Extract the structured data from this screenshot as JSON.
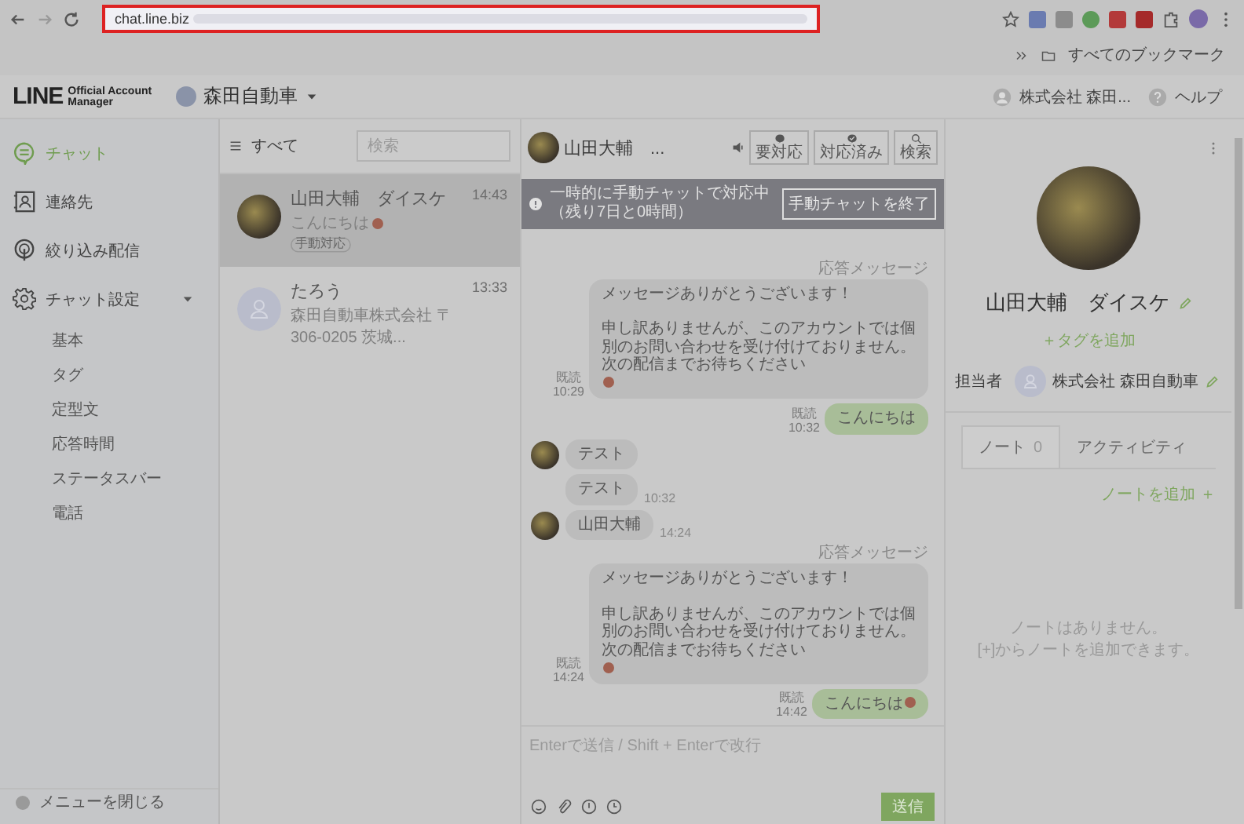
{
  "browser": {
    "url": "chat.line.biz",
    "bookmarks_label": "すべてのブックマーク"
  },
  "header": {
    "logo": "LINE",
    "logo_sub": [
      "Official Account",
      "Manager"
    ],
    "account": "森田自動車",
    "user": "株式会社 森田...",
    "help": "ヘルプ"
  },
  "sidebar": {
    "items": [
      {
        "kind": "chat",
        "label": "チャット",
        "selected": true
      },
      {
        "kind": "contacts",
        "label": "連絡先",
        "selected": false
      },
      {
        "kind": "broadcast",
        "label": "絞り込み配信",
        "selected": false
      },
      {
        "kind": "settings",
        "label": "チャット設定",
        "selected": false,
        "expanded": true,
        "children": [
          {
            "label": "基本",
            "selected": false
          },
          {
            "label": "タグ",
            "selected": false
          },
          {
            "label": "定型文",
            "selected": false
          },
          {
            "label": "応答時間",
            "selected": false
          },
          {
            "label": "ステータスバー",
            "selected": false
          },
          {
            "label": "電話",
            "selected": false
          }
        ]
      }
    ],
    "footer": "メニューを閉じる"
  },
  "chat_list": {
    "filter": "すべて",
    "search": {
      "placeholder": "検索"
    },
    "chats": [
      {
        "photo": true,
        "name": "山田大輔　ダイスケ",
        "preview": "こんにちは",
        "emoji": true,
        "tag": "手動対応",
        "time": "14:43",
        "selected": true
      },
      {
        "photo": false,
        "name": "たろう",
        "preview": "森田自動車株式会社 〒306-0205 茨城...",
        "emoji": false,
        "time": "13:33",
        "selected": false
      }
    ]
  },
  "chat": {
    "title": "山田大輔　...",
    "buttons": [
      {
        "kind": "pending",
        "label": "要対応"
      },
      {
        "kind": "done",
        "label": "対応済み"
      },
      {
        "kind": "search",
        "label": "検索"
      }
    ],
    "banner": {
      "text": "一時的に手動チャットで対応中",
      "remaining": "（残り7日と0時間）",
      "button": "手動チャットを終了"
    },
    "messages": [
      {
        "kind": "auto_reply",
        "label": "応答メッセージ",
        "paragraphs": [
          "メッセージありがとうございます！",
          "申し訳ありませんが、このアカウントでは個別のお問い合わせを受け付けておりません。次の配信までお待ちください"
        ],
        "emoji": true,
        "status": "既読",
        "time": "10:29"
      },
      {
        "kind": "outgoing",
        "text": "こんにちは",
        "emoji": false,
        "status": "既読",
        "time": "10:32"
      },
      {
        "kind": "incoming",
        "avatar": true,
        "text": "テスト"
      },
      {
        "kind": "incoming",
        "avatar": false,
        "text": "テスト",
        "time": "10:32"
      },
      {
        "kind": "incoming",
        "avatar": true,
        "text": "山田大輔",
        "time": "14:24"
      },
      {
        "kind": "auto_reply",
        "label": "応答メッセージ",
        "paragraphs": [
          "メッセージありがとうございます！",
          "申し訳ありませんが、このアカウントでは個別のお問い合わせを受け付けておりません。次の配信までお待ちください"
        ],
        "emoji": true,
        "status": "既読",
        "time": "14:24"
      },
      {
        "kind": "outgoing",
        "text": "こんにちは",
        "emoji": true,
        "status": "既読",
        "time": "14:42"
      }
    ],
    "input": {
      "placeholder": "Enterで送信 / Shift + Enterで改行"
    },
    "send": "送信"
  },
  "profile": {
    "name": "山田大輔　ダイスケ",
    "add_tag": "＋タグを追加",
    "assignee_label": "担当者",
    "assignee": "株式会社 森田自動車",
    "tabs": [
      {
        "label": "ノート",
        "count": "0",
        "selected": true
      },
      {
        "label": "アクティビティ",
        "selected": false
      }
    ],
    "add_note": "ノートを追加 ＋",
    "empty": [
      "ノートはありません。",
      "[+]からノートを追加できます。"
    ]
  }
}
